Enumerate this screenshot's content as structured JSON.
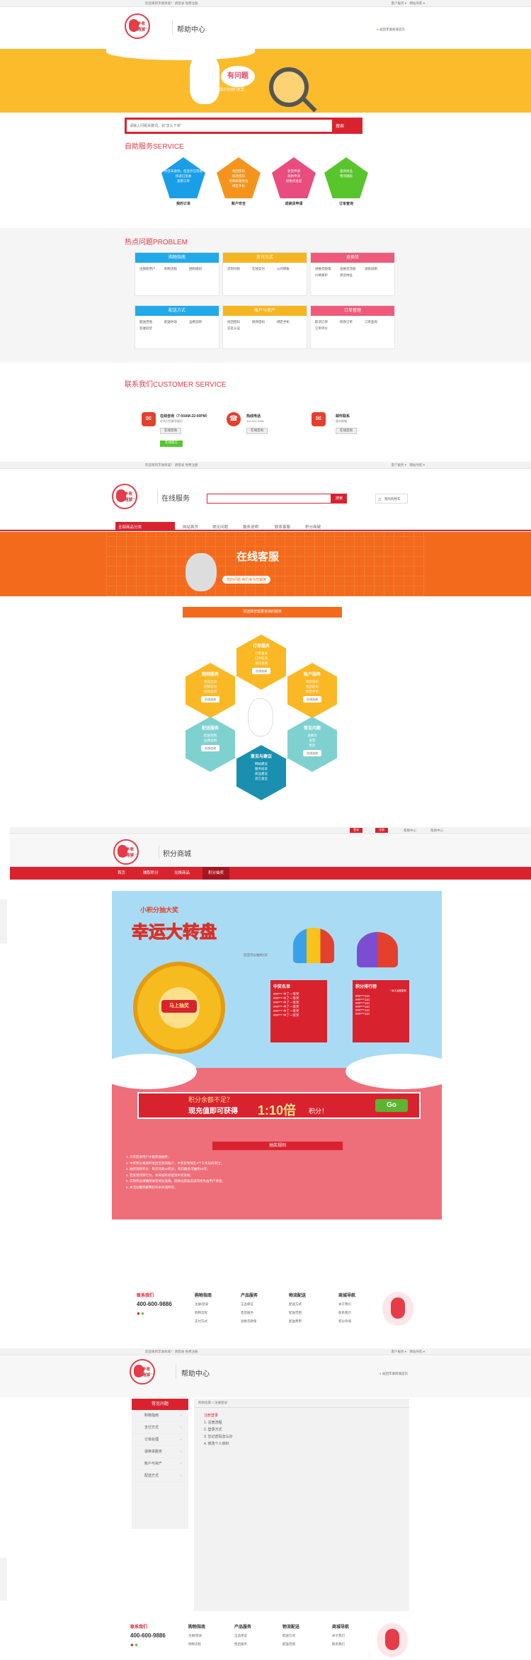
{
  "colors": {
    "red": "#d8232f",
    "yellow": "#fbbb2b",
    "orange": "#f36a1d",
    "pink": "#ee6e7a",
    "sky": "#a9dcf4",
    "teal": "#2db2a4"
  },
  "page1": {
    "topbar": {
      "left": "欢迎来到丰收商城！  请登录  免费注册",
      "right": [
        "客户服务",
        "网站导航"
      ]
    },
    "logo": {
      "main": "丰收商城",
      "sub": "Fengshou · Mall"
    },
    "title": "帮助中心",
    "back_link": "返回丰收商城首页",
    "banner": {
      "title": "有问题",
      "subtitle": "您的需求在我们这里"
    },
    "search": {
      "placeholder": "请输入问题关键词，如“怎么下单”",
      "button": "搜索"
    },
    "service_title": "自助服务SERVICE",
    "services": [
      {
        "lines": [
          "你还未收到，但显示已签收",
          "快递已签收",
          "查看订单"
        ],
        "label": "我的订单",
        "color": "#1a9ee8"
      },
      {
        "lines": [
          "找回密码",
          "修改密码",
          "修改邮箱地址",
          "绑定手机"
        ],
        "label": "账户安全",
        "color": "#f4941c"
      },
      {
        "lines": [
          "退货申请",
          "退款申请",
          "退换货进度"
        ],
        "label": "退换货申请",
        "color": "#e94c7e"
      },
      {
        "lines": [
          "查询商品",
          "物流跟踪"
        ],
        "label": "订单查询",
        "color": "#59c52c"
      }
    ],
    "problem_title": "热点问题PROBLEM",
    "problems": [
      {
        "title": "购物指南",
        "color": "#22a9e8",
        "items": [
          "注册新用户",
          "购物流程",
          "团购规则"
        ]
      },
      {
        "title": "支付方式",
        "color": "#f5b522",
        "items": [
          "货到付款",
          "在线支付",
          "公司转账"
        ]
      },
      {
        "title": "退换货",
        "color": "#ee5b7a",
        "items": [
          "退换货政策",
          "退换货流程",
          "退款说明",
          "价格保护",
          "退货地址"
        ]
      },
      {
        "title": "配送方式",
        "color": "#22a9e8",
        "items": [
          "配送范围",
          "配送时效",
          "运费说明",
          "签收验货"
        ]
      },
      {
        "title": "账户与资产",
        "color": "#f5b522",
        "items": [
          "找回密码",
          "修改密码",
          "绑定手机",
          "实名认证"
        ]
      },
      {
        "title": "订单管理",
        "color": "#ee5b7a",
        "items": [
          "取消订单",
          "修改订单",
          "订单查询",
          "订单评价"
        ]
      }
    ],
    "contact_title": "联系我们CUSTOMER SERVICE",
    "contacts": [
      {
        "title": "在线咨询（7:00AM-22:00PM）",
        "desc": "在线为您解答疑问",
        "button": "在线咨询",
        "button2": "在线留言"
      },
      {
        "title": "热线电话",
        "desc": "400-600-9886",
        "button": "在线咨询"
      },
      {
        "title": "邮件联系",
        "desc": "服务邮箱",
        "button": "在线咨询"
      }
    ]
  },
  "page2": {
    "topbar": {
      "left": "欢迎来到丰收商城！  请登录  免费注册",
      "right": [
        "客户服务",
        "网站导航"
      ]
    },
    "logo": {
      "main": "丰收商城",
      "sub": "Fengshou · Mall"
    },
    "title": "在线服务",
    "search_button": "搜索",
    "cart": "我的购物车",
    "nav": [
      "全部商品分类",
      "网站首页",
      "常见问题",
      "服务说明",
      "联系客服",
      "积分商城"
    ],
    "banner": {
      "title": "在线客服",
      "subtitle": "您的问题 我们来为您解答"
    },
    "bar_text": "请选择您需要咨询的服务",
    "hexes": [
      {
        "title": "订单服务",
        "lines": [
          "订单查询",
          "订单取消",
          "物流查询"
        ],
        "button": "在线咨询",
        "color": "#fbb825"
      },
      {
        "title": "购物服务",
        "lines": [
          "商品咨询",
          "促销活动",
          "团购说明"
        ],
        "button": "在线咨询",
        "color": "#fbb825"
      },
      {
        "title": "账户服务",
        "lines": [
          "修改密码",
          "找回密码",
          "绑定手机"
        ],
        "button": "在线咨询",
        "color": "#fbb825"
      },
      {
        "title": "配送服务",
        "lines": [
          "配送范围",
          "运费说明"
        ],
        "button": "在线咨询",
        "color": "#7fd1cf"
      },
      {
        "title": "常见问题",
        "lines": [
          "退换货",
          "发票",
          "售后"
        ],
        "button": "在线咨询",
        "color": "#7fd1cf"
      },
      {
        "title": "意见与建议",
        "lines": [
          "网站建议",
          "服务投诉",
          "商品建议",
          "其它意见"
        ],
        "button": "在线咨询",
        "color": "#1a8fb0"
      }
    ]
  },
  "page3": {
    "topbar": {
      "btns": [
        "登录",
        "注册"
      ],
      "right": [
        "客服中心",
        "帮助中心"
      ]
    },
    "logo": {
      "main": "丰收商城",
      "sub": "Fengshou · Mall"
    },
    "title": "积分商城",
    "nav": [
      "首页",
      "赚取积分",
      "兑换商品",
      "积分抽奖"
    ],
    "promo": {
      "top": "小积分抽大奖",
      "main": "幸运大转盘",
      "start": "马上抽奖",
      "remain": "您还可以抽奖0次"
    },
    "winners": {
      "title": "中奖名单",
      "rows": [
        "###*** 中了一等奖",
        "###*** 中了一等奖",
        "###*** 中了一等奖",
        "###*** 中了一等奖",
        "###*** 中了一等奖",
        "###*** 中了一等奖"
      ]
    },
    "ranking": {
      "title": "积分排行榜",
      "note": "* 每天凌晨更新",
      "rows": [
        "###***110",
        "###***110",
        "###***110",
        "###***110",
        "###***110",
        "###***110"
      ]
    },
    "recharge": {
      "q": "积分余额不足？",
      "main": "现充值即可获得",
      "multi": "1:10倍",
      "tail": "积分！",
      "btn": "Go"
    },
    "rules_title": "抽奖规则",
    "rules": [
      "1. 只有登录用户才能参加抽奖；",
      "2. 中奖积分将即时发放至您的账户，中奖实物将在3个工作日内寄出；",
      "3. 抽奖消耗积分：每次消耗10积分，每日最多可抽奖10次；",
      "4. 若发现作弊行为，本商城有权取消中奖资格；",
      "5. 实物奖品请确保收货地址准确，因地址错误造成的损失由用户承担；",
      "6. 本活动最终解释权归本商城所有。"
    ]
  },
  "footer": {
    "contact_title": "联系我们",
    "phone": "400-600-9886",
    "cols": [
      {
        "title": "购物指南",
        "items": [
          "注册/登录",
          "购物流程",
          "支付方式"
        ]
      },
      {
        "title": "产品服务",
        "items": [
          "正品保证",
          "售后服务",
          "退换货政策"
        ]
      },
      {
        "title": "物流配送",
        "items": [
          "配送方式",
          "配送范围",
          "配送费用"
        ]
      },
      {
        "title": "商城导航",
        "items": [
          "关于我们",
          "联系我们",
          "积分商城"
        ]
      }
    ]
  },
  "page4": {
    "topbar": {
      "left": "欢迎来到丰收商城！  请登录  免费注册",
      "right": [
        "客户服务",
        "网站导航"
      ]
    },
    "logo": {
      "main": "丰收商城",
      "sub": "Fengshou · Mall"
    },
    "title": "帮助中心",
    "back_link": "返回丰收商城首页",
    "sidebar_title": "常见问题",
    "sidebar": [
      "购物指南",
      "支付方式",
      "订单处理",
      "退换货服务",
      "账户与资产",
      "配送方式"
    ],
    "breadcrumb": "购物指南 > 注册登录",
    "content_title": "注册登录",
    "content": [
      "1. 注册流程",
      "2. 登录方式",
      "3. 忘记密码怎么办",
      "4. 修改个人资料"
    ]
  }
}
